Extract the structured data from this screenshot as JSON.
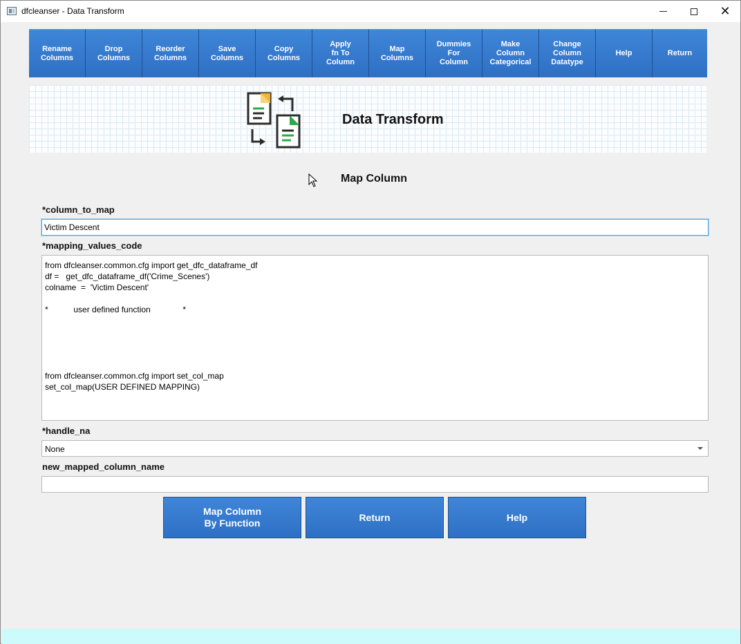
{
  "window": {
    "title": "dfcleanser - Data Transform",
    "minimize_glyph": "",
    "maximize_glyph": "",
    "close_glyph": "✕"
  },
  "toolbar": {
    "buttons": [
      {
        "label": "Rename\nColumns"
      },
      {
        "label": "Drop\nColumns"
      },
      {
        "label": "Reorder\nColumns"
      },
      {
        "label": "Save\nColumns"
      },
      {
        "label": "Copy\nColumns"
      },
      {
        "label": "Apply\nfn To\nColumn"
      },
      {
        "label": "Map\nColumns"
      },
      {
        "label": "Dummies\nFor\nColumn"
      },
      {
        "label": "Make\nColumn\nCategorical"
      },
      {
        "label": "Change\nColumn\nDatatype"
      },
      {
        "label": "Help"
      },
      {
        "label": "Return"
      }
    ]
  },
  "banner": {
    "title": "Data Transform",
    "icon": "transform-documents-icon"
  },
  "form": {
    "title": "Map Column",
    "column_to_map": {
      "label": "*column_to_map",
      "value": "Victim Descent"
    },
    "mapping_values_code": {
      "label": "*mapping_values_code",
      "value": "from dfcleanser.common.cfg import get_dfc_dataframe_df\ndf =   get_dfc_dataframe_df('Crime_Scenes')\ncolname  =  'Victim Descent'\n\n*           user defined function              *\n\n\n\n\n\nfrom dfcleanser.common.cfg import set_col_map\nset_col_map(USER DEFINED MAPPING)"
    },
    "handle_na": {
      "label": "*handle_na",
      "selected": "None"
    },
    "new_mapped_column_name": {
      "label": "new_mapped_column_name",
      "value": ""
    }
  },
  "actions": {
    "map_by_function": "Map Column\nBy Function",
    "return": "Return",
    "help": "Help"
  },
  "colors": {
    "button_blue": "#3a7fd5",
    "footer": "#cdfbfb"
  }
}
